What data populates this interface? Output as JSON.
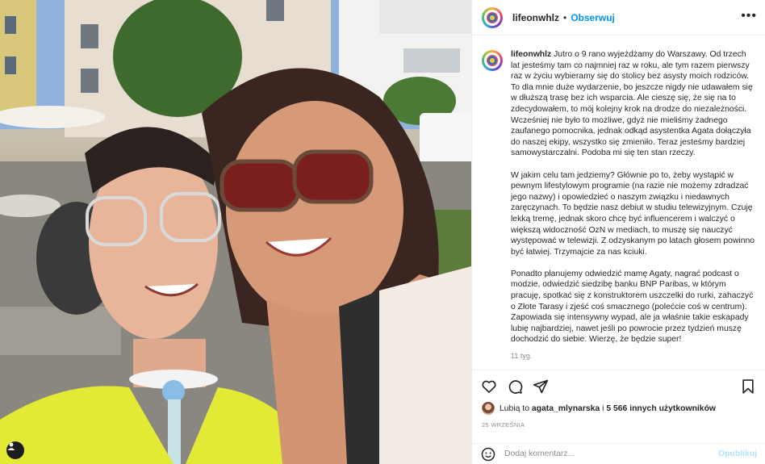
{
  "post": {
    "username": "lifeonwhlz",
    "follow_label": "Obserwuj",
    "separator": "•",
    "more_label": "•••",
    "caption_paragraphs": [
      "Jutro o 9 rano wyjeżdżamy do Warszawy. Od trzech lat jesteśmy tam co najmniej raz w roku, ale tym razem pierwszy raz w życiu wybieramy się do stolicy bez asysty moich rodziców. To dla mnie duże wydarzenie, bo jeszcze nigdy nie udawałem się w dłuższą trasę bez ich wsparcia. Ale cieszę się, że się na to zdecydowałem, to mój kolejny krok na drodze do niezależności. Wcześniej nie było to możliwe, gdyż nie mieliśmy żadnego zaufanego pomocnika, jednak odkąd asystentka Agata dołączyła do naszej ekipy, wszystko się zmieniło. Teraz jesteśmy bardziej samowystarczalni. Podoba mi się ten stan rzeczy.",
      "W jakim celu tam jedziemy? Głównie po to, żeby wystąpić w pewnym lifestylowym programie (na razie nie możemy zdradzać jego nazwy) i opowiedzieć o naszym związku i niedawnych zaręczynach. To będzie nasz debiut w studiu telewizyjnym. Czuję lekką tremę, jednak skoro chcę być influencerem i walczyć o większą widoczność OzN w mediach, to muszę się nauczyć występować w telewizji. Z odzyskanym po latach głosem powinno być łatwiej. Trzymajcie za nas kciuki.",
      "Ponadto planujemy odwiedzić mamę Agaty, nagrać podcast o modzie, odwiedzić siedzibę banku BNP Paribas, w którym pracuję, spotkać się z konstruktorem uszczelki do rurki, zahaczyć o Złote Tarasy i zjeść coś smacznego (polećcie coś w centrum). Zapowiada się intensywny wypad, ale ja właśnie takie eskapady lubię najbardziej, nawet jeśli po powrocie przez tydzień muszę dochodzić do siebie. Wierzę, że będzie super!"
    ],
    "age": "11 tyg.",
    "likes_prefix": "Lubią to",
    "likes_user": "agata_mlynarska",
    "likes_connector": "i",
    "likes_others": "5 566 innych użytkowników",
    "date": "25 WRZEŚNIA",
    "comment_placeholder": "Dodaj komentarz...",
    "publish_label": "Opublikuj"
  },
  "icons": {
    "like": "heart-icon",
    "comment": "comment-icon",
    "share": "send-icon",
    "save": "bookmark-icon",
    "emoji": "emoji-icon",
    "tag": "user-tag-icon"
  },
  "colors": {
    "accent": "#0095f6",
    "publish_disabled": "#b2dffc",
    "muted": "#8e8e8e"
  }
}
